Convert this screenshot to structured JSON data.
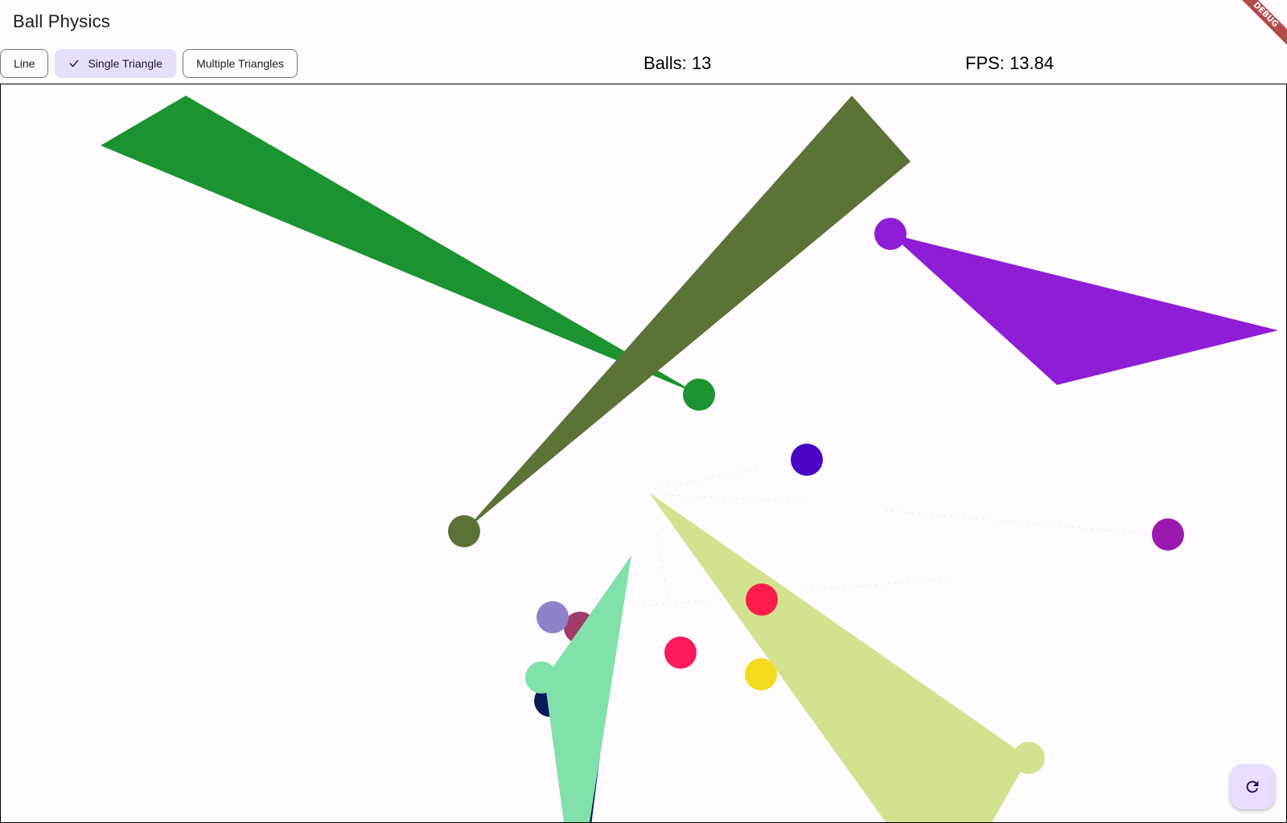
{
  "app": {
    "title": "Ball Physics",
    "debug_banner": "DEBUG"
  },
  "modes": {
    "items": [
      {
        "label": "Line",
        "selected": false
      },
      {
        "label": "Single Triangle",
        "selected": true
      },
      {
        "label": "Multiple Triangles",
        "selected": false
      }
    ]
  },
  "stats": {
    "balls_text": "Balls: 13",
    "fps_text": "FPS: 13.84"
  },
  "simulation": {
    "balls": [
      {
        "color": "#1b9330"
      },
      {
        "color": "#5b7336"
      },
      {
        "color": "#8f1dd5"
      },
      {
        "color": "#4a06c4"
      },
      {
        "color": "#9b19b1"
      },
      {
        "color": "#ff1b4b"
      },
      {
        "color": "#fb1a5e"
      },
      {
        "color": "#f2db1d"
      },
      {
        "color": "#d3e28f"
      },
      {
        "color": "#8e82c8"
      },
      {
        "color": "#a23a6a"
      },
      {
        "color": "#81e1aa"
      },
      {
        "color": "#071a5a"
      }
    ]
  },
  "controls": {
    "reset_icon": "refresh-icon"
  }
}
